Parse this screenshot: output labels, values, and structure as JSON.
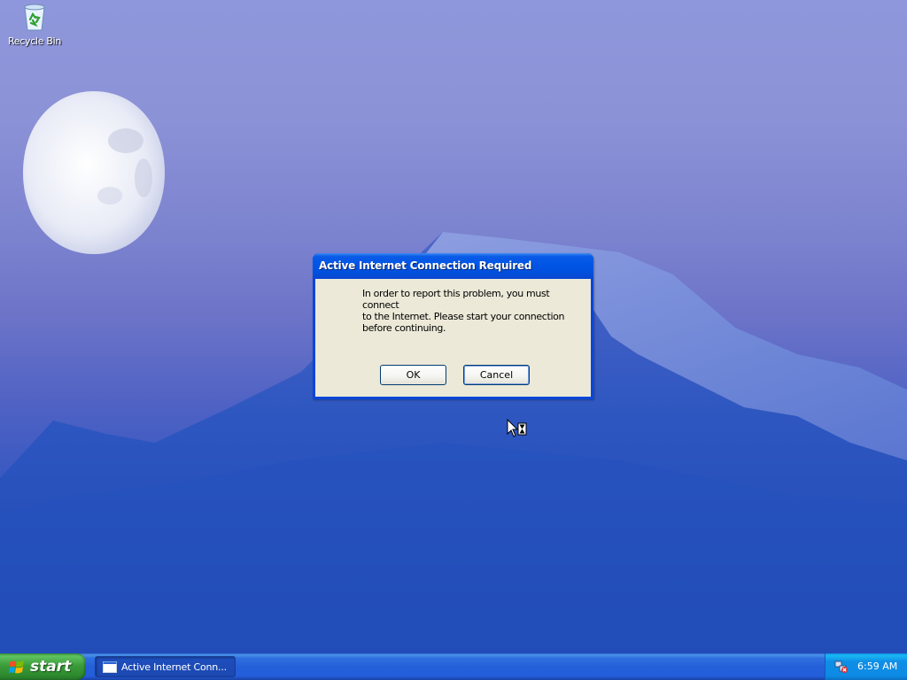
{
  "desktop": {
    "icons": [
      {
        "label": "Recycle Bin",
        "icon": "recycle-bin-icon"
      }
    ]
  },
  "dialog": {
    "title": "Active Internet Connection Required",
    "message": "In order to report this problem, you must connect\nto the Internet.  Please start your connection\nbefore continuing.",
    "ok_label": "OK",
    "cancel_label": "Cancel"
  },
  "taskbar": {
    "start_label": "start",
    "task_item_label": "Active Internet Conn...",
    "clock": "6:59 AM"
  },
  "colors": {
    "taskbar_blue": "#245edb",
    "start_green": "#3b9c3b",
    "dialog_face": "#ece9d8",
    "title_blue": "#0055e5"
  }
}
